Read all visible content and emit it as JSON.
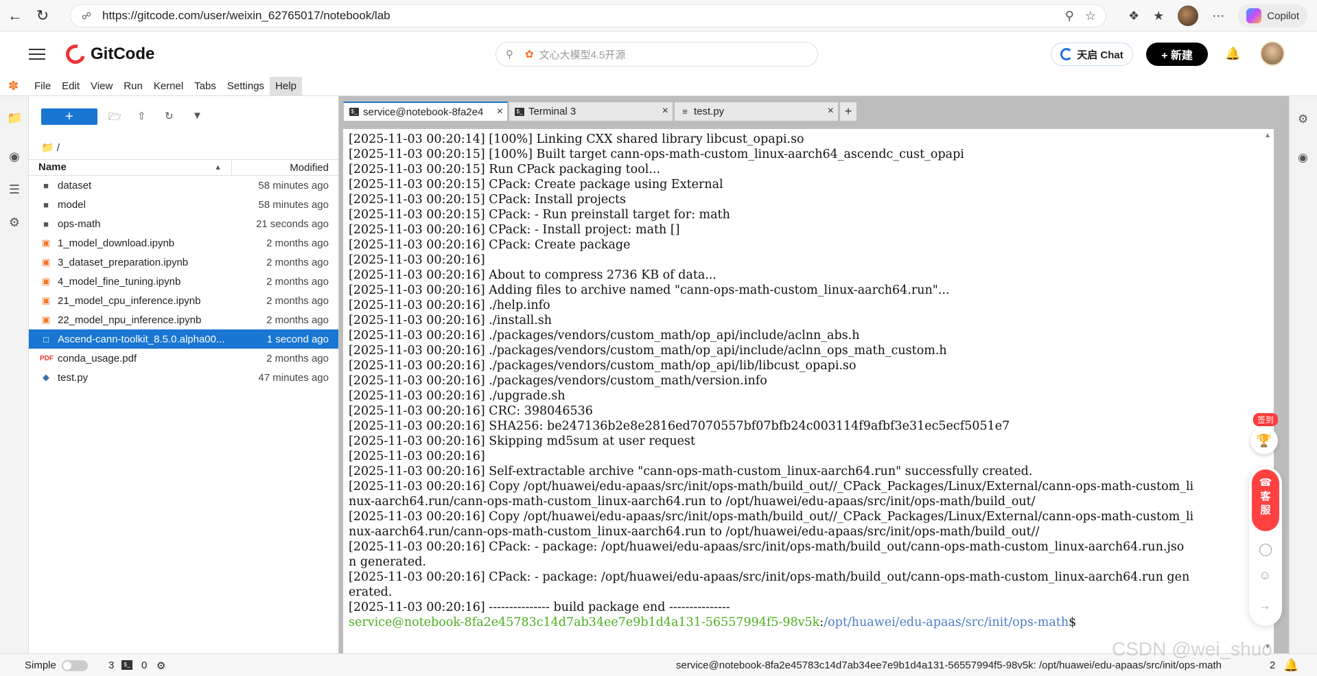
{
  "browser": {
    "url": "https://gitcode.com/user/weixin_62765017/notebook/lab",
    "copilot_label": "Copilot"
  },
  "gitcode": {
    "brand": "GitCode",
    "search_placeholder": "文心大模型4.5开源",
    "chat_label": "天启 Chat",
    "new_label": "+ 新建"
  },
  "menubar": {
    "items": [
      "File",
      "Edit",
      "View",
      "Run",
      "Kernel",
      "Tabs",
      "Settings",
      "Help"
    ],
    "active": "Help"
  },
  "filebrowser": {
    "new_label": "+",
    "path": "/",
    "col_name": "Name",
    "col_modified": "Modified",
    "files": [
      {
        "name": "dataset",
        "modified": "58 minutes ago",
        "type": "folder"
      },
      {
        "name": "model",
        "modified": "58 minutes ago",
        "type": "folder"
      },
      {
        "name": "ops-math",
        "modified": "21 seconds ago",
        "type": "folder"
      },
      {
        "name": "1_model_download.ipynb",
        "modified": "2 months ago",
        "type": "notebook"
      },
      {
        "name": "3_dataset_preparation.ipynb",
        "modified": "2 months ago",
        "type": "notebook"
      },
      {
        "name": "4_model_fine_tuning.ipynb",
        "modified": "2 months ago",
        "type": "notebook"
      },
      {
        "name": "21_model_cpu_inference.ipynb",
        "modified": "2 months ago",
        "type": "notebook"
      },
      {
        "name": "22_model_npu_inference.ipynb",
        "modified": "2 months ago",
        "type": "notebook"
      },
      {
        "name": "Ascend-cann-toolkit_8.5.0.alpha00...",
        "modified": "1 second ago",
        "type": "file",
        "selected": true
      },
      {
        "name": "conda_usage.pdf",
        "modified": "2 months ago",
        "type": "pdf"
      },
      {
        "name": "test.py",
        "modified": "47 minutes ago",
        "type": "python"
      }
    ]
  },
  "tabs": [
    {
      "label": "service@notebook-8fa2e4",
      "icon": "terminal",
      "current": true
    },
    {
      "label": "Terminal 3",
      "icon": "terminal",
      "current": false
    },
    {
      "label": "test.py",
      "icon": "text",
      "current": false
    }
  ],
  "terminal": {
    "lines": [
      "[2025-11-03 00:20:14] [100%] Linking CXX shared library libcust_opapi.so",
      "[2025-11-03 00:20:15] [100%] Built target cann-ops-math-custom_linux-aarch64_ascendc_cust_opapi",
      "[2025-11-03 00:20:15] Run CPack packaging tool...",
      "[2025-11-03 00:20:15] CPack: Create package using External",
      "[2025-11-03 00:20:15] CPack: Install projects",
      "[2025-11-03 00:20:15] CPack: - Run preinstall target for: math",
      "[2025-11-03 00:20:16] CPack: - Install project: math []",
      "[2025-11-03 00:20:16] CPack: Create package",
      "[2025-11-03 00:20:16]",
      "[2025-11-03 00:20:16] About to compress 2736 KB of data...",
      "[2025-11-03 00:20:16] Adding files to archive named \"cann-ops-math-custom_linux-aarch64.run\"...",
      "[2025-11-03 00:20:16] ./help.info",
      "[2025-11-03 00:20:16] ./install.sh",
      "[2025-11-03 00:20:16] ./packages/vendors/custom_math/op_api/include/aclnn_abs.h",
      "[2025-11-03 00:20:16] ./packages/vendors/custom_math/op_api/include/aclnn_ops_math_custom.h",
      "[2025-11-03 00:20:16] ./packages/vendors/custom_math/op_api/lib/libcust_opapi.so",
      "[2025-11-03 00:20:16] ./packages/vendors/custom_math/version.info",
      "[2025-11-03 00:20:16] ./upgrade.sh",
      "[2025-11-03 00:20:16] CRC: 398046536",
      "[2025-11-03 00:20:16] SHA256: be247136b2e8e2816ed7070557bf07bfb24c003114f9afbf3e31ec5ecf5051e7",
      "[2025-11-03 00:20:16] Skipping md5sum at user request",
      "[2025-11-03 00:20:16]",
      "[2025-11-03 00:20:16] Self-extractable archive \"cann-ops-math-custom_linux-aarch64.run\" successfully created.",
      "[2025-11-03 00:20:16] Copy /opt/huawei/edu-apaas/src/init/ops-math/build_out//_CPack_Packages/Linux/External/cann-ops-math-custom_li",
      "nux-aarch64.run/cann-ops-math-custom_linux-aarch64.run to /opt/huawei/edu-apaas/src/init/ops-math/build_out/",
      "[2025-11-03 00:20:16] Copy /opt/huawei/edu-apaas/src/init/ops-math/build_out//_CPack_Packages/Linux/External/cann-ops-math-custom_li",
      "nux-aarch64.run/cann-ops-math-custom_linux-aarch64.run to /opt/huawei/edu-apaas/src/init/ops-math/build_out//",
      "[2025-11-03 00:20:16] CPack: - package: /opt/huawei/edu-apaas/src/init/ops-math/build_out/cann-ops-math-custom_linux-aarch64.run.jso",
      "n generated.",
      "[2025-11-03 00:20:16] CPack: - package: /opt/huawei/edu-apaas/src/init/ops-math/build_out/cann-ops-math-custom_linux-aarch64.run gen",
      "erated.",
      "[2025-11-03 00:20:16] --------------- build package end ---------------"
    ],
    "prompt_user": "service@notebook-8fa2e45783c14d7ab34ee7e9b1d4a131-56557994f5-98v5k",
    "prompt_sep": ":",
    "prompt_path": "/opt/huawei/edu-apaas/src/init/ops-math",
    "prompt_end": "$"
  },
  "floating": {
    "sign_label": "签到",
    "service_label": "客服"
  },
  "statusbar": {
    "mode_label": "Simple",
    "terminals_count": "3",
    "kernels_count": "0",
    "status_text": "service@notebook-8fa2e45783c14d7ab34ee7e9b1d4a131-56557994f5-98v5k: /opt/huawei/edu-apaas/src/init/ops-math",
    "right_count": "2"
  },
  "watermark": "CSDN @wei_shuo"
}
